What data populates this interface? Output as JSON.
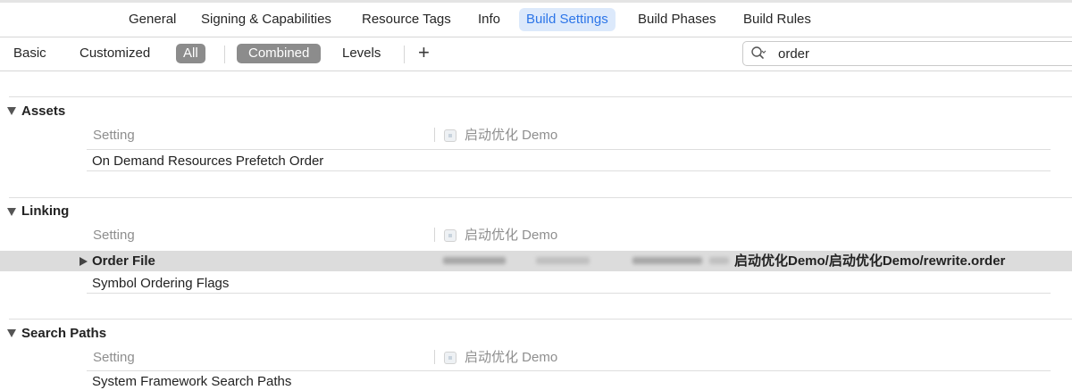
{
  "tabs": [
    {
      "label": "General",
      "active": false
    },
    {
      "label": "Signing & Capabilities",
      "active": false
    },
    {
      "label": "Resource Tags",
      "active": false
    },
    {
      "label": "Info",
      "active": false
    },
    {
      "label": "Build Settings",
      "active": true
    },
    {
      "label": "Build Phases",
      "active": false
    },
    {
      "label": "Build Rules",
      "active": false
    }
  ],
  "filter": {
    "basic": "Basic",
    "customized": "Customized",
    "all": "All",
    "combined": "Combined",
    "levels": "Levels",
    "add": "+"
  },
  "search": {
    "value": "order",
    "icon": "magnifier-dropdown-icon"
  },
  "sections": {
    "assets": {
      "title": "Assets",
      "header_setting": "Setting",
      "header_target": "启动优化 Demo",
      "rows": [
        "On Demand Resources Prefetch Order"
      ]
    },
    "linking": {
      "title": "Linking",
      "header_setting": "Setting",
      "header_target": "启动优化 Demo",
      "selected_row": {
        "name": "Order File",
        "value": "启动优化Demo/启动优化Demo/rewrite.order"
      },
      "rows": [
        "Symbol Ordering Flags"
      ]
    },
    "search_paths": {
      "title": "Search Paths",
      "header_setting": "Setting",
      "header_target": "启动优化 Demo",
      "rows": [
        "System Framework Search Paths"
      ]
    }
  },
  "colors": {
    "accent": "#2c75e8",
    "active_tab_bg": "#dce9fb",
    "pill_bg": "#8c8c8c",
    "selected_row_bg": "#dcdcdc"
  }
}
